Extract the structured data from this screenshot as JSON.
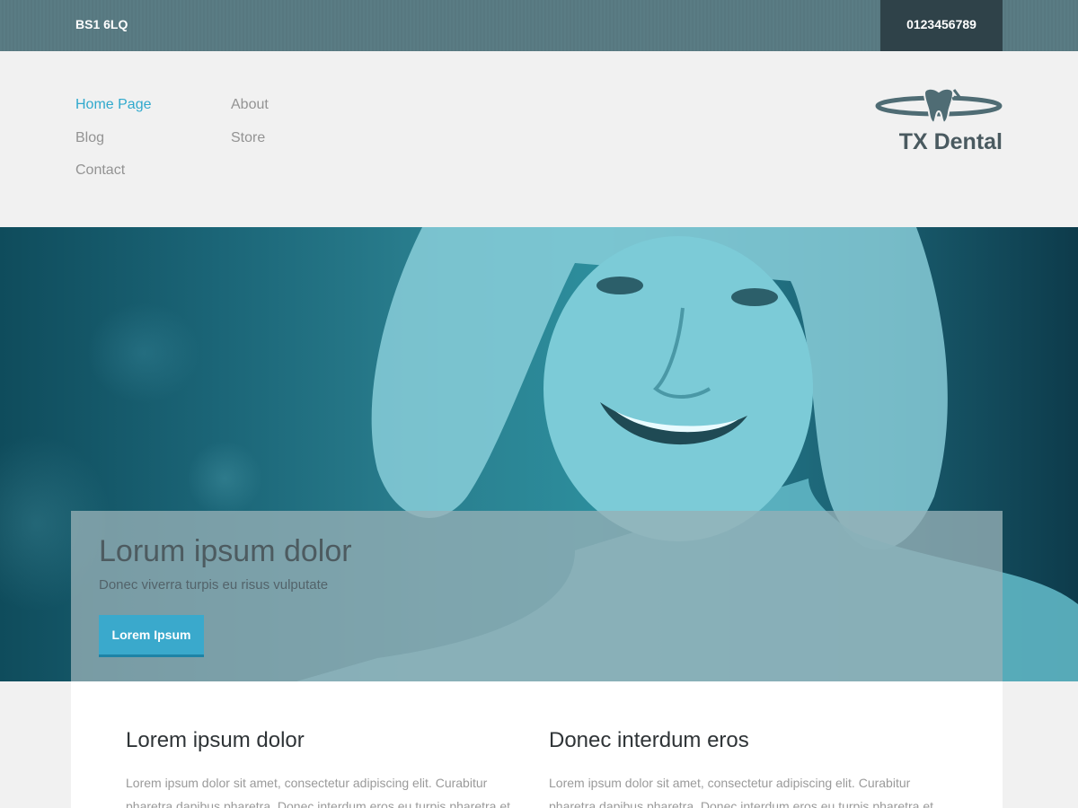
{
  "topbar": {
    "address": "BS1 6LQ",
    "phone": "0123456789"
  },
  "nav": [
    {
      "label": "Home Page",
      "active": true
    },
    {
      "label": "About",
      "active": false
    },
    {
      "label": "Blog",
      "active": false
    },
    {
      "label": "Store",
      "active": false
    },
    {
      "label": "Contact",
      "active": false
    }
  ],
  "logo": {
    "brand": "TX Dental",
    "icon": "tooth-icon"
  },
  "hero": {
    "title": "Lorum ipsum dolor",
    "subtitle": "Donec viverra turpis eu risus vulputate",
    "button": "Lorem Ipsum",
    "image": "smiling-woman-photo"
  },
  "columns": [
    {
      "title": "Lorem ipsum dolor",
      "text": "Lorem ipsum dolor sit amet, consectetur adipiscing elit. Curabitur pharetra dapibus pharetra. Donec interdum eros eu turpis pharetra et"
    },
    {
      "title": "Donec interdum eros",
      "text": "Lorem ipsum dolor sit amet, consectetur adipiscing elit. Curabitur pharetra dapibus pharetra. Donec interdum eros eu turpis pharetra et"
    }
  ],
  "colors": {
    "accent": "#30a9cd",
    "topbar": "#5a7c84",
    "phone_bg": "#2f4249",
    "brand_text": "#4a5a60"
  }
}
